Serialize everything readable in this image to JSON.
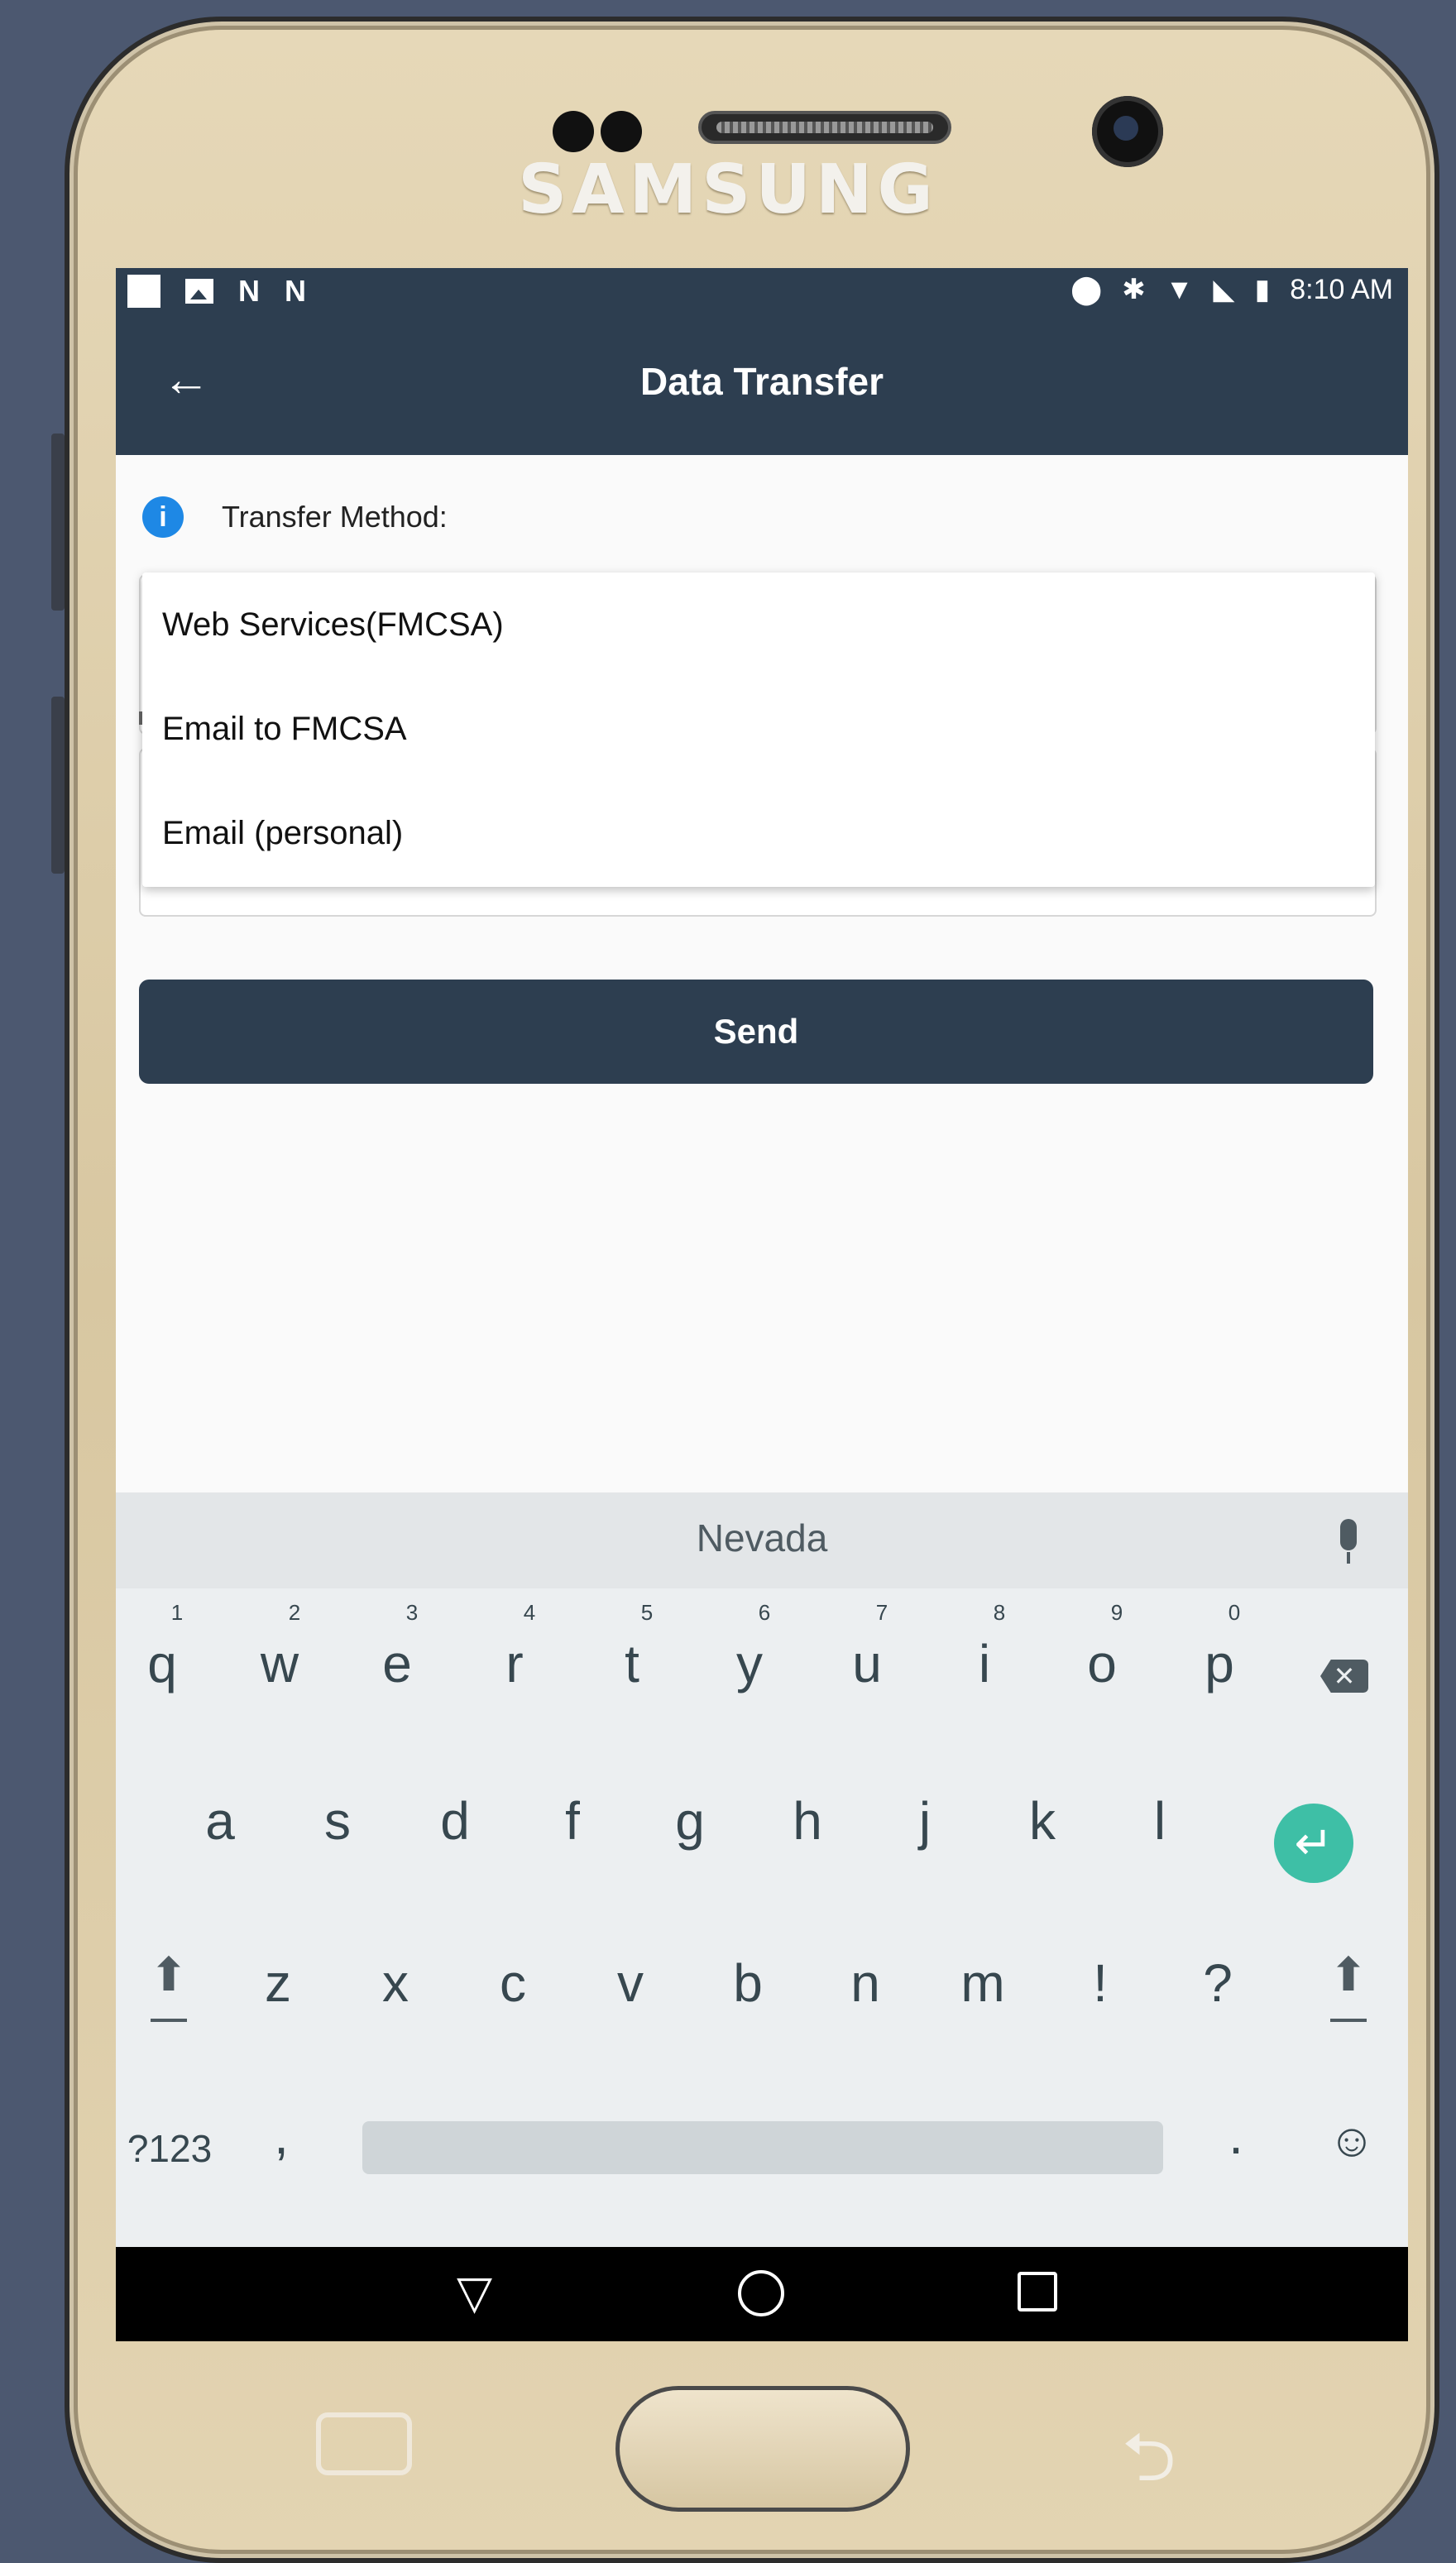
{
  "device": {
    "brand": "SAMSUNG"
  },
  "status_bar": {
    "time": "8:10 AM"
  },
  "app_bar": {
    "title": "Data Transfer",
    "back_icon": "←"
  },
  "form": {
    "info_icon": "i",
    "transfer_method_label": "Transfer Method:",
    "dropdown_options": [
      "Web Services(FMCSA)",
      "Email to FMCSA",
      "Email (personal)"
    ],
    "send_label": "Send"
  },
  "keyboard": {
    "suggestion": "Nevada",
    "row1": [
      "q",
      "w",
      "e",
      "r",
      "t",
      "y",
      "u",
      "i",
      "o",
      "p"
    ],
    "row1_numbers": [
      "1",
      "2",
      "3",
      "4",
      "5",
      "6",
      "7",
      "8",
      "9",
      "0"
    ],
    "row2": [
      "a",
      "s",
      "d",
      "f",
      "g",
      "h",
      "j",
      "k",
      "l"
    ],
    "row3": [
      "z",
      "x",
      "c",
      "v",
      "b",
      "n",
      "m",
      "!",
      "?"
    ],
    "symbols_key": "?123",
    "comma": ",",
    "period": ".",
    "emoji": "☺",
    "enter_glyph": "↵",
    "shift_glyph": "⬆",
    "backspace_glyph": "✕"
  },
  "nav_bar": {
    "back": "▽"
  },
  "colors": {
    "app_bar": "#2d3e50",
    "accent_info": "#1e88e5",
    "enter_key": "#3ebfa6",
    "background": "#4c5870"
  }
}
